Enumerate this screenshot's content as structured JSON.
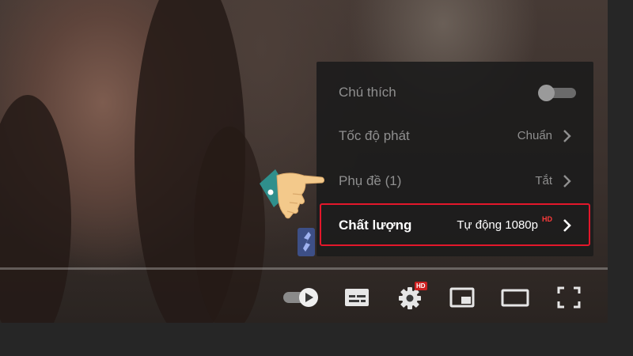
{
  "settings_menu": {
    "items": [
      {
        "label": "Chú thích",
        "control": "toggle",
        "toggle_on": false
      },
      {
        "label": "Tốc độ phát",
        "value": "Chuẩn"
      },
      {
        "label": "Phụ đề (1)",
        "value": "Tắt"
      },
      {
        "label": "Chất lượng",
        "value": "Tự động 1080p",
        "badge": "HD",
        "highlighted": true
      }
    ]
  },
  "controls": {
    "autoplay_icon": "autoplay-toggle-icon",
    "subtitles_icon": "subtitles-icon",
    "settings_icon": "gear-icon",
    "settings_badge": "HD",
    "miniplayer_icon": "miniplayer-icon",
    "theater_icon": "theater-mode-icon",
    "fullscreen_icon": "fullscreen-icon"
  },
  "annotation": {
    "pointer": "pointing-hand-icon",
    "highlight_color": "#e3172b"
  },
  "colors": {
    "menu_bg": "#1c1c1c",
    "menu_text_dim": "#8f8f8f",
    "menu_text_active": "#ffffff",
    "hd_red": "#cc1f1f"
  }
}
